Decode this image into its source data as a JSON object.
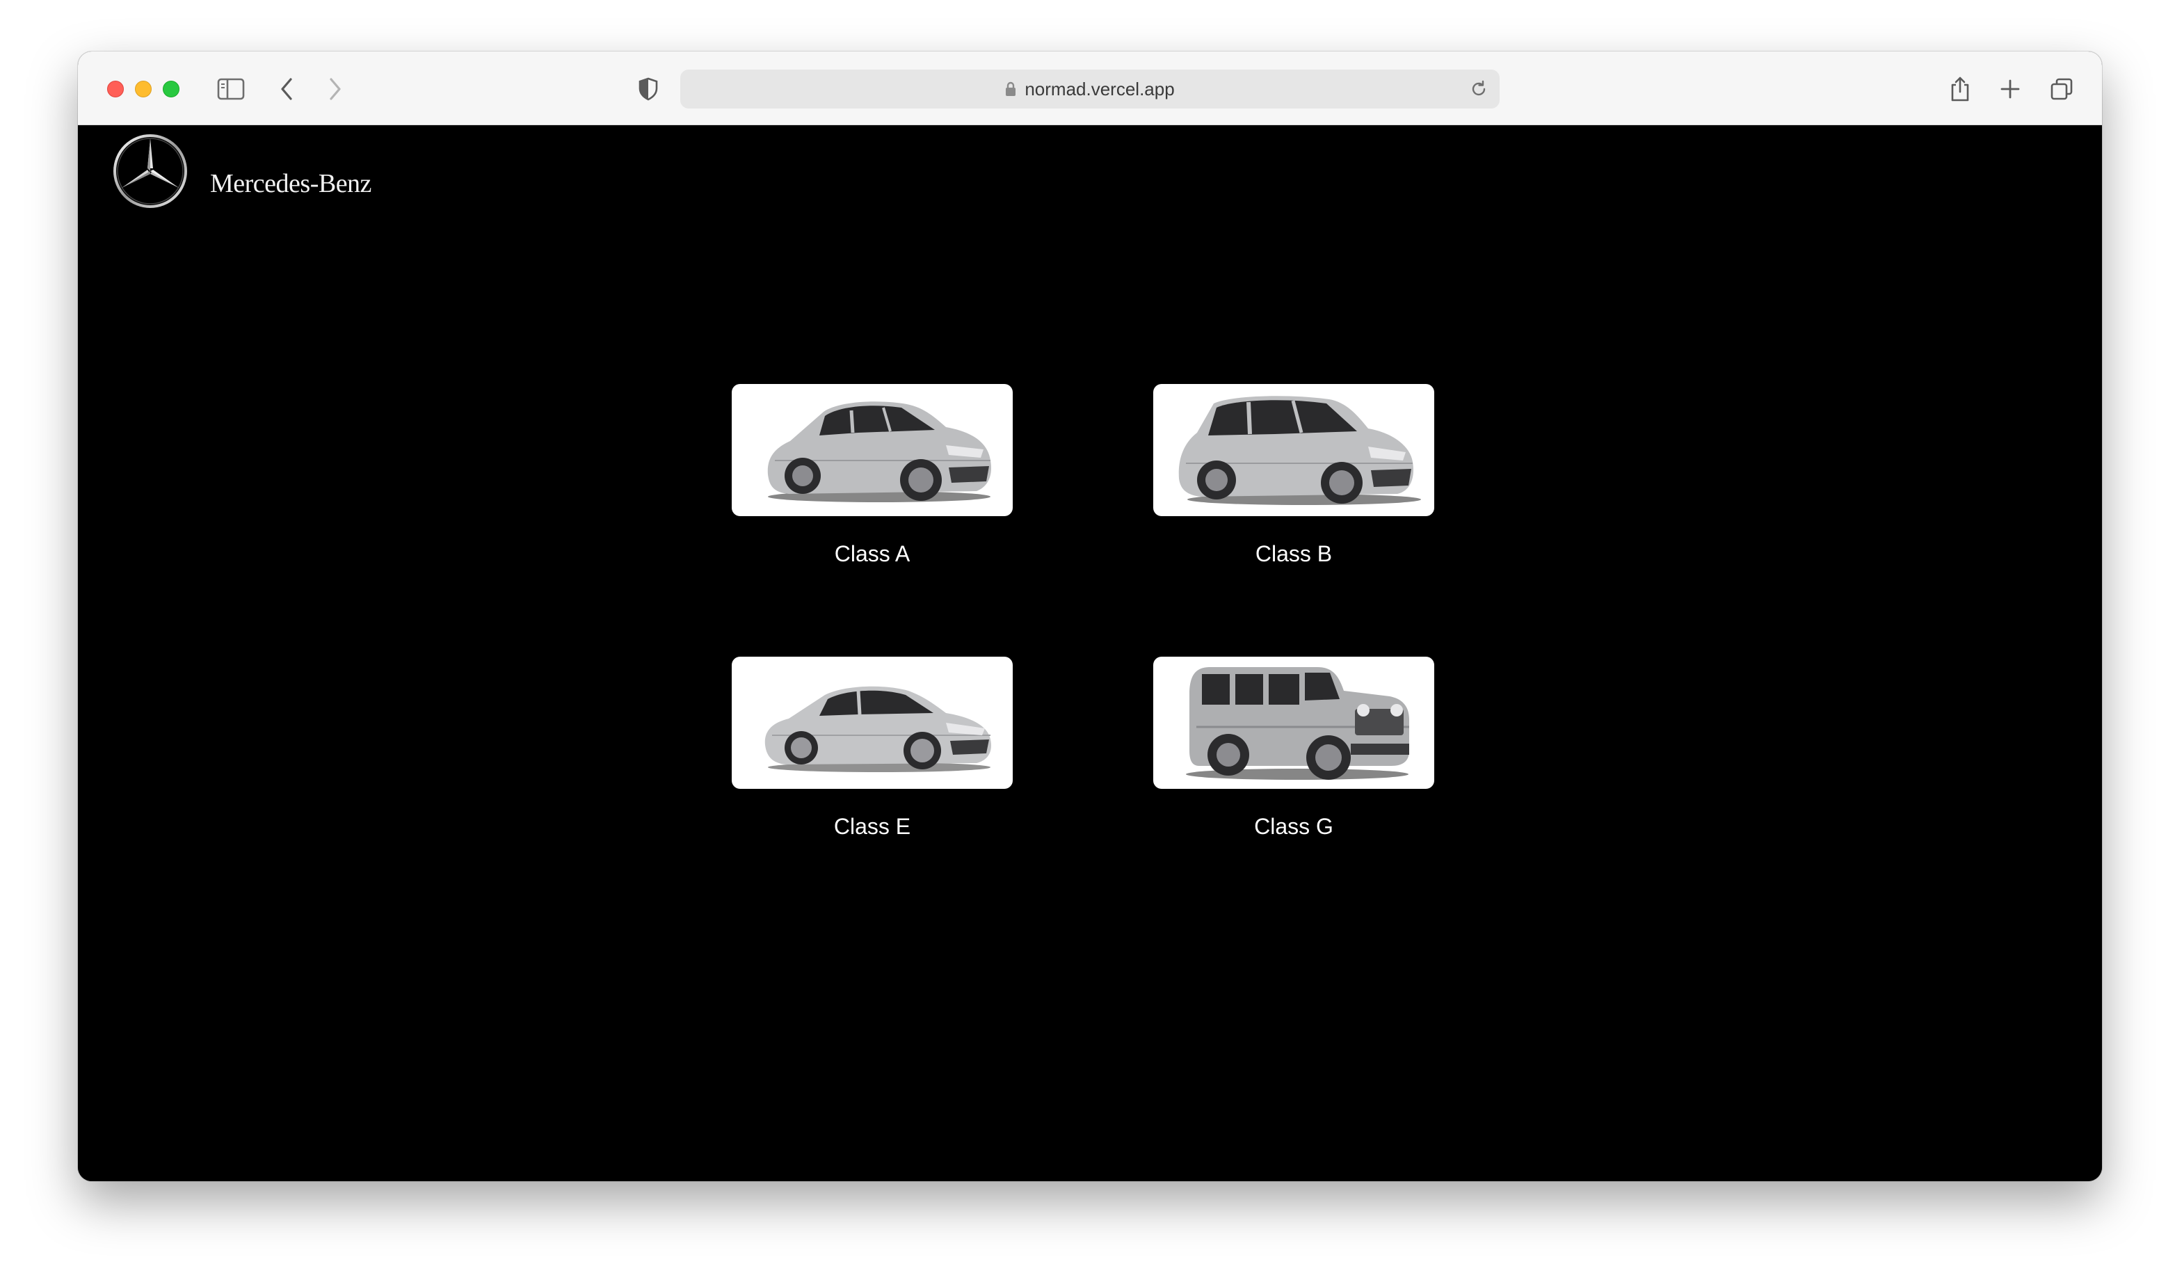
{
  "browser": {
    "url": "normad.vercel.app"
  },
  "brand": {
    "name": "Mercedes-Benz"
  },
  "cars": [
    {
      "label": "Class A",
      "icon": "class-a-car-image"
    },
    {
      "label": "Class B",
      "icon": "class-b-car-image"
    },
    {
      "label": "Class E",
      "icon": "class-e-car-image"
    },
    {
      "label": "Class G",
      "icon": "class-g-car-image"
    }
  ],
  "colors": {
    "page_background": "#000000",
    "card_background": "#ffffff",
    "car_body": "#b9babc"
  }
}
